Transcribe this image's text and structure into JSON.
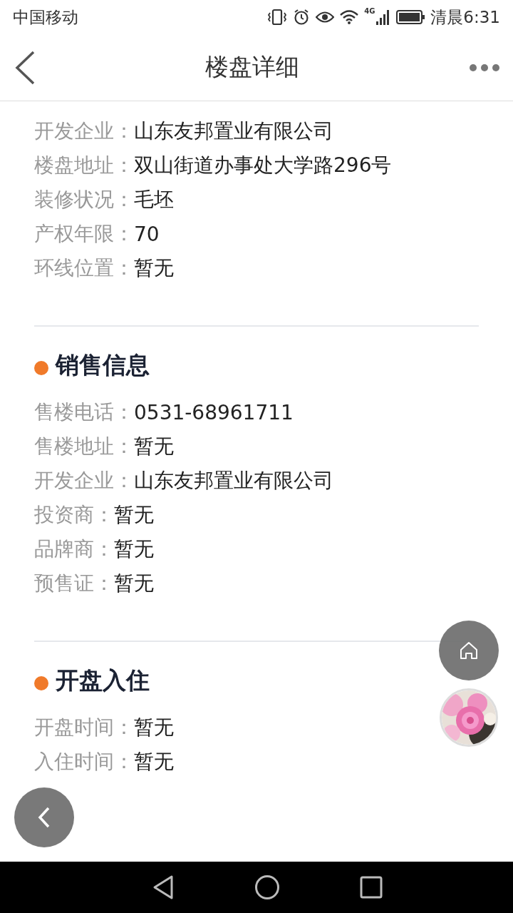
{
  "status_bar": {
    "carrier": "中国移动",
    "network": "4G",
    "time": "清晨6:31"
  },
  "header": {
    "title": "楼盘详细"
  },
  "sections": [
    {
      "rows": [
        {
          "label": "开发企业：",
          "value": "山东友邦置业有限公司"
        },
        {
          "label": "楼盘地址：",
          "value": "双山街道办事处大学路296号"
        },
        {
          "label": "装修状况：",
          "value": "毛坯"
        },
        {
          "label": "产权年限：",
          "value": "70"
        },
        {
          "label": "环线位置：",
          "value": "暂无"
        }
      ]
    },
    {
      "title": "销售信息",
      "rows": [
        {
          "label": "售楼电话：",
          "value": "0531-68961711"
        },
        {
          "label": "售楼地址：",
          "value": "暂无"
        },
        {
          "label": "开发企业：",
          "value": "山东友邦置业有限公司"
        },
        {
          "label": "投资商：",
          "value": "暂无"
        },
        {
          "label": "品牌商：",
          "value": "暂无"
        },
        {
          "label": "预售证：",
          "value": "暂无"
        }
      ]
    },
    {
      "title": "开盘入住",
      "rows": [
        {
          "label": "开盘时间：",
          "value": "暂无"
        },
        {
          "label": "入住时间：",
          "value": "暂无"
        }
      ]
    }
  ]
}
